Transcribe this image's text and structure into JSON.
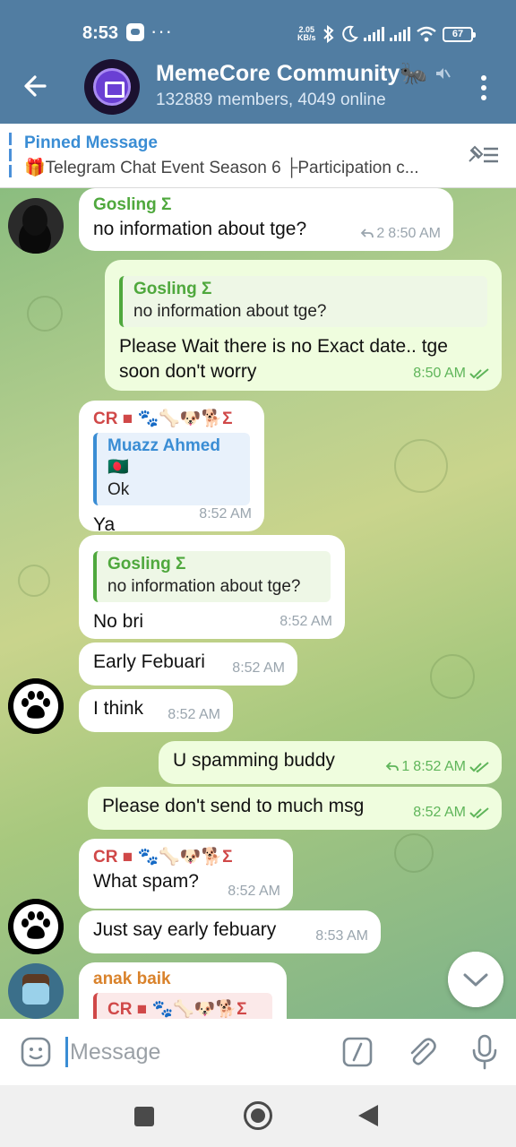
{
  "status_bar": {
    "time": "8:53",
    "dots": "···",
    "speed_value": "2.05",
    "speed_unit": "KB/s",
    "battery": "67"
  },
  "header": {
    "title": "MemeCore Community🐜",
    "subtitle": "132889 members, 4049 online"
  },
  "pinned": {
    "title": "Pinned Message",
    "text": "🎁Telegram Chat Event Season 6  ├Participation c..."
  },
  "messages": [
    {
      "sender": "Gosling Σ",
      "text": "no information about tge?",
      "replies": "2",
      "time": "8:50 AM"
    },
    {
      "quote_name": "Gosling Σ",
      "quote_text": "no information about tge?",
      "text": "Please Wait there is no Exact date.. tge soon don't worry",
      "time": "8:50 AM"
    },
    {
      "sender": "CR ■ 🐾🦴🐶🐕Σ",
      "quote_name": "Muazz Ahmed🇧🇩",
      "quote_text": "Ok",
      "text": "Ya",
      "time": "8:52 AM"
    },
    {
      "quote_name": "Gosling Σ",
      "quote_text": "no information about tge?",
      "text": "No bri",
      "time": "8:52 AM"
    },
    {
      "text": "Early Febuari",
      "time": "8:52 AM"
    },
    {
      "text": "I think",
      "time": "8:52 AM"
    },
    {
      "text": "U  spamming buddy",
      "replies": "1",
      "time": "8:52 AM"
    },
    {
      "text": "Please don't send to much msg",
      "time": "8:52 AM"
    },
    {
      "sender": "CR ■ 🐾🦴🐶🐕Σ",
      "text": "What spam?",
      "time": "8:52 AM"
    },
    {
      "text": "Just say early febuary",
      "time": "8:53 AM"
    },
    {
      "sender": "anak baik",
      "quote_name": "CR ■ 🐾🦴🐶🐕Σ"
    }
  ],
  "input": {
    "placeholder": "Message"
  },
  "colors": {
    "header_bg": "#517da2",
    "accent_blue": "#3a8dd4",
    "outgoing_bubble": "#effdde",
    "name_green": "#4fa83d",
    "name_red": "#d04848",
    "name_orange": "#d9822b"
  },
  "icons": [
    "back-arrow-icon",
    "mute-icon",
    "more-vert-icon",
    "pin-list-icon",
    "reply-icon",
    "double-check-icon",
    "chevron-down-icon",
    "sticker-icon",
    "command-icon",
    "attach-icon",
    "mic-icon"
  ]
}
